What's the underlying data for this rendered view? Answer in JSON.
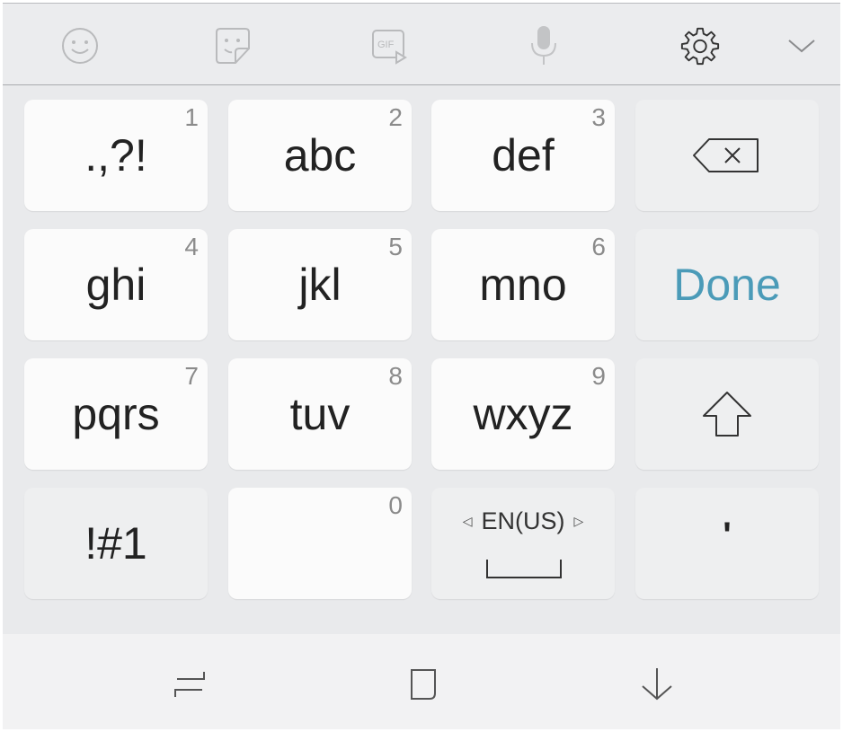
{
  "toolbar": {
    "icons": [
      "emoji-icon",
      "sticker-icon",
      "gif-icon",
      "microphone-icon",
      "settings-gear-icon",
      "collapse-chevron-icon"
    ],
    "gif_text": "GIF"
  },
  "keys": {
    "row1": [
      {
        "label": ".,?!",
        "num": "1"
      },
      {
        "label": "abc",
        "num": "2"
      },
      {
        "label": "def",
        "num": "3"
      }
    ],
    "row2": [
      {
        "label": "ghi",
        "num": "4"
      },
      {
        "label": "jkl",
        "num": "5"
      },
      {
        "label": "mno",
        "num": "6"
      }
    ],
    "row3": [
      {
        "label": "pqrs",
        "num": "7"
      },
      {
        "label": "tuv",
        "num": "8"
      },
      {
        "label": "wxyz",
        "num": "9"
      }
    ],
    "row4": {
      "symbols": "!#1",
      "zero_num": "0",
      "language": "EN(US)",
      "apostrophe": "'"
    },
    "done": "Done"
  },
  "colors": {
    "done_accent": "#4b9bb8",
    "key_bg": "#fbfbfb",
    "func_key_bg": "#eeeff0",
    "board_bg": "#e9eaec"
  },
  "navbar": {
    "icons": [
      "recent-apps-icon",
      "home-icon",
      "back-down-arrow-icon"
    ]
  }
}
